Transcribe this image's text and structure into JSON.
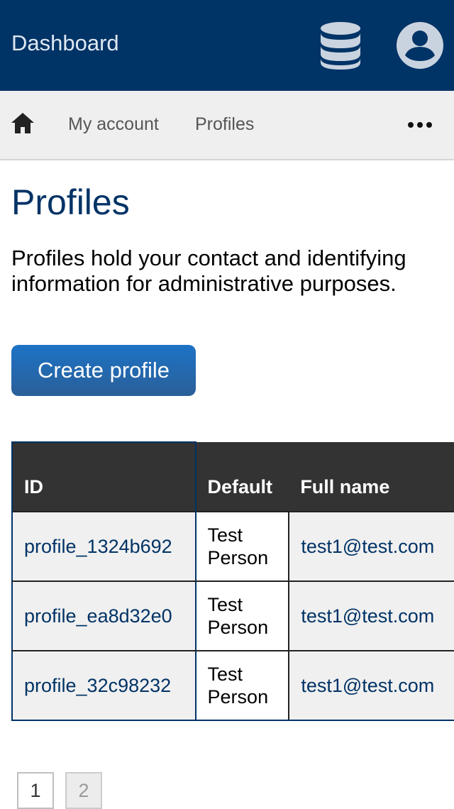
{
  "header": {
    "title": "Dashboard",
    "icons": [
      "database-icon",
      "user-account-icon"
    ],
    "background": "#003366"
  },
  "nav": {
    "home_icon": "home-icon",
    "links": [
      {
        "label": "My account"
      },
      {
        "label": "Profiles"
      }
    ],
    "more_icon": "more-dots-icon"
  },
  "main": {
    "title": "Profiles",
    "intro": "Profiles hold your contact and identifying information for administrative purposes.",
    "create_button": "Create profile"
  },
  "table": {
    "columns": [
      "ID",
      "Default",
      "Full name"
    ],
    "rows": [
      {
        "id": "profile_1324b692",
        "default": "Test Person",
        "full_name": "test1@test.com"
      },
      {
        "id": "profile_ea8d32e0",
        "default": "Test Person",
        "full_name": "test1@test.com"
      },
      {
        "id": "profile_32c98232",
        "default": "Test Person",
        "full_name": "test1@test.com"
      }
    ]
  },
  "pagination": {
    "pages": [
      "1",
      "2"
    ],
    "current": "1"
  },
  "colors": {
    "brand": "#003366",
    "button": "#1d73c6",
    "table_header": "#333333"
  }
}
